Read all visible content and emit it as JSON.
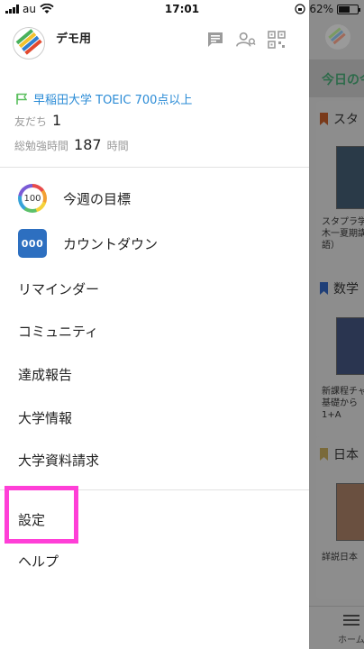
{
  "status_bar": {
    "carrier": "au",
    "time": "17:01",
    "battery": "62%",
    "battery_level": 0.62
  },
  "drawer": {
    "username": "デモ用",
    "goal": "早稲田大学 TOEIC 700点以上",
    "friends_label": "友だち",
    "friends_count": "1",
    "study_time_label": "総勉強時間",
    "study_time_value": "187",
    "study_time_unit": "時間",
    "weekly_goal_badge": "100",
    "countdown_badge": "000",
    "menu": {
      "weekly_goal": "今週の目標",
      "countdown": "カウントダウン",
      "reminder": "リマインダー",
      "community": "コミュニティ",
      "achievement_report": "達成報告",
      "university_info": "大学情報",
      "university_materials": "大学資料請求",
      "settings": "設定",
      "help": "ヘルプ"
    }
  },
  "background_app": {
    "tab_label": "今日の今",
    "section1_title": "スタ",
    "book1_caption_lines": [
      "スタプラ学",
      "木一夏期講",
      "語）"
    ],
    "section2_title": "数学",
    "book2_caption_lines": [
      "新課程チャ",
      "基礎から",
      "1+A"
    ],
    "section3_title": "日本",
    "book3_caption_lines": [
      "詳説日本"
    ],
    "bottom_nav_label": "ホーム"
  },
  "colors": {
    "accent_green": "#3a9b5c",
    "link_blue": "#2a8bd6",
    "highlight_pink": "#ff3fd7",
    "countdown_blue": "#2d6fc0",
    "bookmark_orange": "#e8641d",
    "bookmark_blue": "#2a5fb8",
    "bookmark_tan": "#c9a24a"
  }
}
